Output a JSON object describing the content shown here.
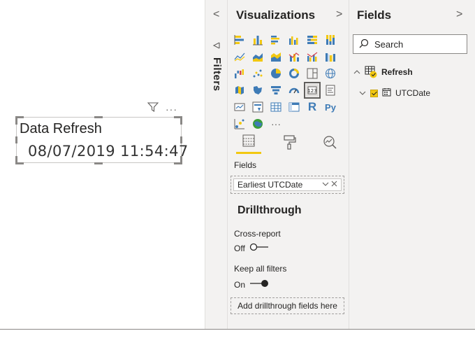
{
  "card": {
    "title": "Data Refresh",
    "value": "08/07/2019 11:54:47",
    "more": "···"
  },
  "filters_pane": {
    "label": "Filters",
    "collapse_chevron": "<",
    "expand_icon": "triangle-left-icon"
  },
  "visualizations": {
    "title": "Visualizations",
    "chevron": ">",
    "more_visuals": "···",
    "r_visual": "R",
    "python_visual": "Py",
    "tabs": [
      "fields-tab-icon",
      "format-paint-roller-icon",
      "analytics-magnifier-icon"
    ],
    "fields_label": "Fields",
    "field_pill": "Earliest UTCDate",
    "drillthrough_title": "Drillthrough",
    "cross_report_label": "Cross-report",
    "cross_report_state": "Off",
    "keep_filters_label": "Keep all filters",
    "keep_filters_state": "On",
    "drop_zone": "Add drillthrough fields here"
  },
  "fields": {
    "title": "Fields",
    "chevron": ">",
    "search_placeholder": "Search",
    "table_name": "Refresh",
    "column_name": "UTCDate"
  },
  "colors": {
    "accent_yellow": "#f2c811",
    "pane_bg": "#f3f2f1",
    "text": "#252423"
  }
}
